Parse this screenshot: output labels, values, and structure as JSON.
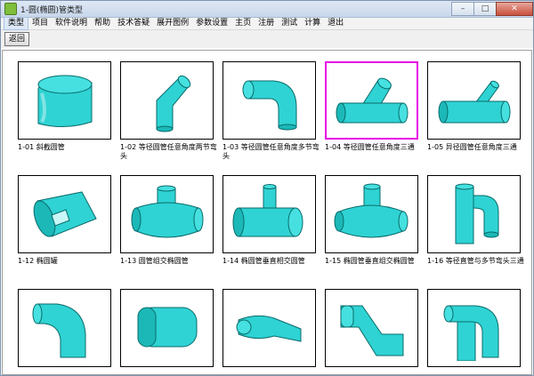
{
  "window": {
    "title": "1-圆(椭圆)管类型"
  },
  "window_buttons": {
    "minimize": "–",
    "maximize": "□",
    "close": "✕"
  },
  "menu": [
    "类型",
    "项目",
    "软件说明",
    "帮助",
    "技术答疑",
    "展开图例",
    "参数设置",
    "主页",
    "注册",
    "测试",
    "计算",
    "退出"
  ],
  "toolbar": {
    "back_label": "返回"
  },
  "items": [
    {
      "caption": "1-01  斜截圆管",
      "icon": "oblique-cut-tube"
    },
    {
      "caption": "1-02  等径圆管任意角度两节弯头",
      "icon": "two-segment-elbow"
    },
    {
      "caption": "1-03  等径圆管任意角度多节弯头",
      "icon": "multi-segment-elbow"
    },
    {
      "caption": "1-04  等径圆管任意角度三通",
      "icon": "equal-tee",
      "selected": true
    },
    {
      "caption": "1-05  异径圆管任意角度三通",
      "icon": "reducing-tee"
    },
    {
      "caption": "1-12  椭圆罐",
      "icon": "elliptical-tank"
    },
    {
      "caption": "1-13  圆管组交椭圆管",
      "icon": "round-on-elliptical"
    },
    {
      "caption": "1-14  椭圆管垂直相交圆管",
      "icon": "elliptical-perpendicular-round"
    },
    {
      "caption": "1-15  椭圆管垂直组交椭圆管",
      "icon": "elliptical-perpendicular-elliptical"
    },
    {
      "caption": "1-16  等径直管与多节弯头三通",
      "icon": "pipe-elbow-tee"
    },
    {
      "caption": "",
      "icon": "square-to-round-elbow"
    },
    {
      "caption": "",
      "icon": "oval-tube"
    },
    {
      "caption": "",
      "icon": "flattened-tube"
    },
    {
      "caption": "",
      "icon": "offset-transition"
    },
    {
      "caption": "",
      "icon": "elbow-tee-bottom"
    }
  ]
}
